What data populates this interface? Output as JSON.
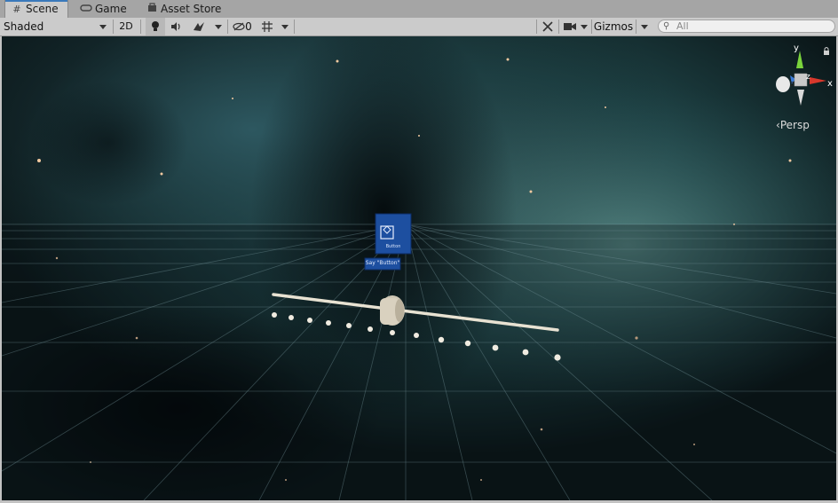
{
  "tabs": [
    {
      "label": "Scene",
      "icon": "grid-icon",
      "active": true
    },
    {
      "label": "Game",
      "icon": "gamepad-icon",
      "active": false
    },
    {
      "label": "Asset Store",
      "icon": "bag-icon",
      "active": false
    }
  ],
  "toolbar": {
    "draw_mode": "Shaded",
    "mode_2d": "2D",
    "hidden_count": "0",
    "gizmos": "Gizmos",
    "search_placeholder": "All"
  },
  "gizmo": {
    "axis_y": "y",
    "axis_x": "x",
    "axis_z": "z",
    "projection": "Persp"
  },
  "scene": {
    "panel_label": "Button",
    "tag_label": "Say \"Button\""
  },
  "colors": {
    "accent": "#3a79bb",
    "axis_x": "#d8382c",
    "axis_y": "#7ad33c",
    "axis_z": "#3a7bd8",
    "panel": "#1d4fa0"
  }
}
